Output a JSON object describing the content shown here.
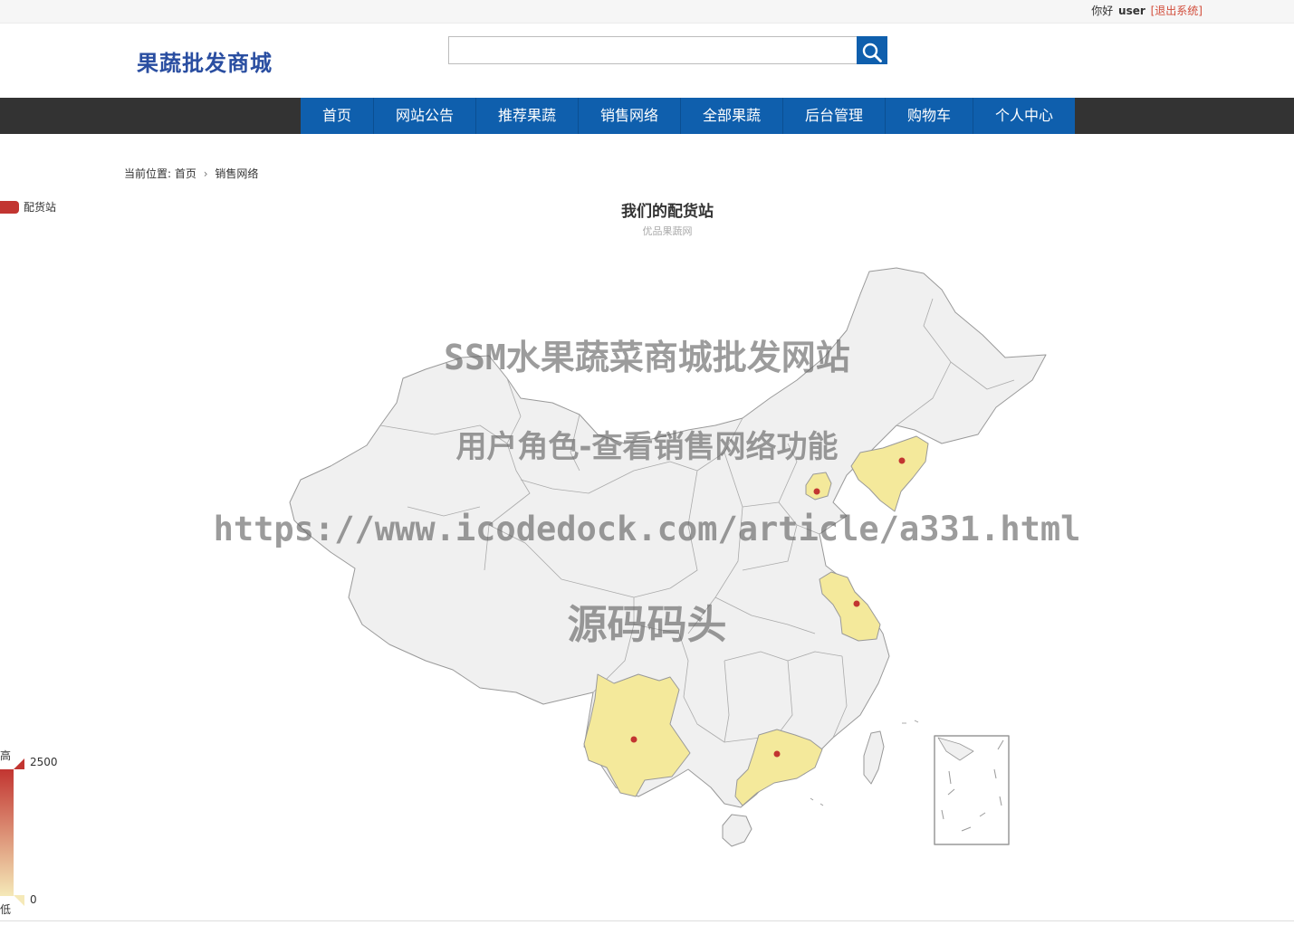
{
  "topbar": {
    "greeting": "你好",
    "username": "user",
    "logout": "[退出系统]"
  },
  "header": {
    "logo": "果蔬批发商城",
    "search_placeholder": "",
    "search_value": ""
  },
  "nav": {
    "items": [
      {
        "label": "首页"
      },
      {
        "label": "网站公告"
      },
      {
        "label": "推荐果蔬"
      },
      {
        "label": "销售网络"
      },
      {
        "label": "全部果蔬"
      },
      {
        "label": "后台管理"
      },
      {
        "label": "购物车"
      },
      {
        "label": "个人中心"
      }
    ]
  },
  "breadcrumb": {
    "prefix": "当前位置:",
    "home": "首页",
    "current": "销售网络"
  },
  "map": {
    "title": "我们的配货站",
    "subtitle": "优品果蔬网",
    "legend_label": "配货站",
    "visual_map": {
      "high_label": "高",
      "low_label": "低",
      "max": "2500",
      "min": "0"
    },
    "colors": {
      "land": "#f0f0f0",
      "border": "#999999",
      "highlight": "#f4e99b",
      "point": "#c23531"
    }
  },
  "watermarks": [
    "SSM水果蔬菜商城批发网站",
    "用户角色-查看销售网络功能",
    "https://www.icodedock.com/article/a331.html",
    "源码码头"
  ]
}
